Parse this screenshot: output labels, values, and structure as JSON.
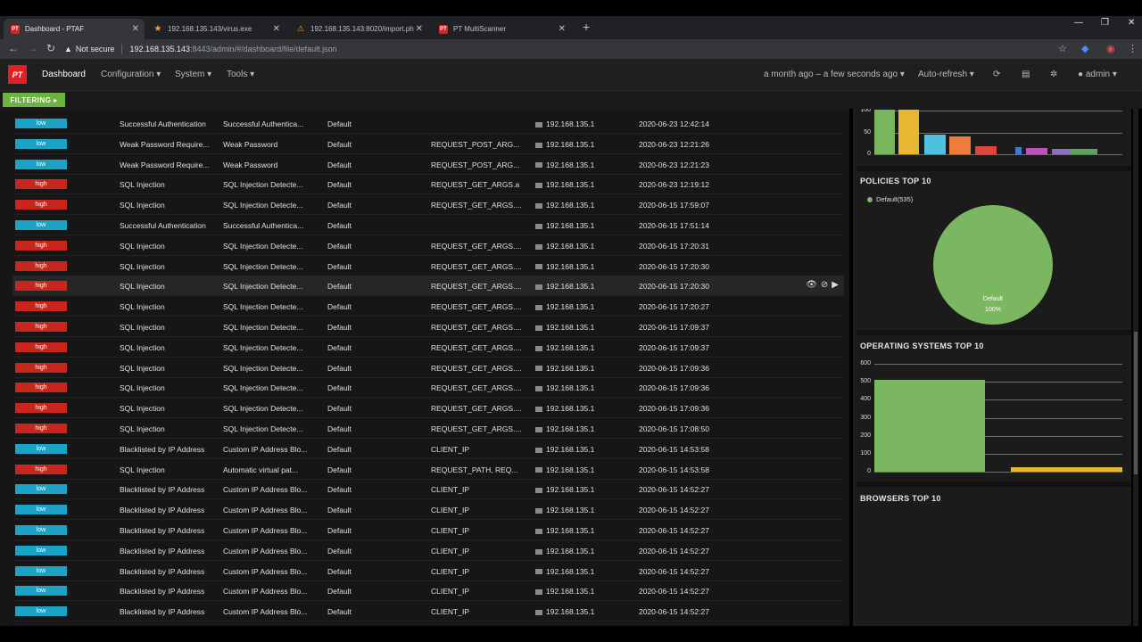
{
  "browser": {
    "tabs": [
      {
        "title": "Dashboard - PTAF",
        "icon": "pt-favicon",
        "active": true
      },
      {
        "title": "192.168.135.143/virus.exe",
        "icon": "star-icon"
      },
      {
        "title": "192.168.135.143:8020/import.ph",
        "icon": "warning-icon"
      },
      {
        "title": "PT MultiScanner",
        "icon": "pt-favicon"
      }
    ],
    "new_tab": "+",
    "not_secure": "Not secure",
    "url_host": "192.168.135.143",
    "url_path": ":8443/admin/#/dashboard/file/default.json"
  },
  "app": {
    "logo": "PT",
    "nav": {
      "dashboard": "Dashboard",
      "configuration": "Configuration ▾",
      "system": "System ▾",
      "tools": "Tools ▾",
      "time_range": "a month ago – a few seconds ago ▾",
      "auto_refresh": "Auto-refresh ▾",
      "user": "admin ▾"
    },
    "filtering": "FILTERING ▸"
  },
  "events": [
    {
      "sev": "low",
      "name": "Successful Authentication",
      "rule": "Successful Authentica...",
      "policy": "Default",
      "param": "",
      "ip": "192.168.135.1",
      "time": "2020-06-23 12:42:14"
    },
    {
      "sev": "low",
      "name": "Weak Password Require...",
      "rule": "Weak Password",
      "policy": "Default",
      "param": "REQUEST_POST_ARG...",
      "ip": "192.168.135.1",
      "time": "2020-06-23 12:21:26"
    },
    {
      "sev": "low",
      "name": "Weak Password Require...",
      "rule": "Weak Password",
      "policy": "Default",
      "param": "REQUEST_POST_ARG...",
      "ip": "192.168.135.1",
      "time": "2020-06-23 12:21:23"
    },
    {
      "sev": "high",
      "name": "SQL Injection",
      "rule": "SQL Injection Detecte...",
      "policy": "Default",
      "param": "REQUEST_GET_ARGS.a",
      "ip": "192.168.135.1",
      "time": "2020-06-23 12:19:12"
    },
    {
      "sev": "high",
      "name": "SQL Injection",
      "rule": "SQL Injection Detecte...",
      "policy": "Default",
      "param": "REQUEST_GET_ARGS....",
      "ip": "192.168.135.1",
      "time": "2020-06-15 17:59:07"
    },
    {
      "sev": "low",
      "name": "Successful Authentication",
      "rule": "Successful Authentica...",
      "policy": "Default",
      "param": "",
      "ip": "192.168.135.1",
      "time": "2020-06-15 17:51:14"
    },
    {
      "sev": "high",
      "name": "SQL Injection",
      "rule": "SQL Injection Detecte...",
      "policy": "Default",
      "param": "REQUEST_GET_ARGS....",
      "ip": "192.168.135.1",
      "time": "2020-06-15 17:20:31"
    },
    {
      "sev": "high",
      "name": "SQL Injection",
      "rule": "SQL Injection Detecte...",
      "policy": "Default",
      "param": "REQUEST_GET_ARGS....",
      "ip": "192.168.135.1",
      "time": "2020-06-15 17:20:30"
    },
    {
      "sev": "high",
      "name": "SQL Injection",
      "rule": "SQL Injection Detecte...",
      "policy": "Default",
      "param": "REQUEST_GET_ARGS....",
      "ip": "192.168.135.1",
      "time": "2020-06-15 17:20:30",
      "hover": true
    },
    {
      "sev": "high",
      "name": "SQL Injection",
      "rule": "SQL Injection Detecte...",
      "policy": "Default",
      "param": "REQUEST_GET_ARGS....",
      "ip": "192.168.135.1",
      "time": "2020-06-15 17:20:27"
    },
    {
      "sev": "high",
      "name": "SQL Injection",
      "rule": "SQL Injection Detecte...",
      "policy": "Default",
      "param": "REQUEST_GET_ARGS....",
      "ip": "192.168.135.1",
      "time": "2020-06-15 17:09:37"
    },
    {
      "sev": "high",
      "name": "SQL Injection",
      "rule": "SQL Injection Detecte...",
      "policy": "Default",
      "param": "REQUEST_GET_ARGS....",
      "ip": "192.168.135.1",
      "time": "2020-06-15 17:09:37"
    },
    {
      "sev": "high",
      "name": "SQL Injection",
      "rule": "SQL Injection Detecte...",
      "policy": "Default",
      "param": "REQUEST_GET_ARGS....",
      "ip": "192.168.135.1",
      "time": "2020-06-15 17:09:36"
    },
    {
      "sev": "high",
      "name": "SQL Injection",
      "rule": "SQL Injection Detecte...",
      "policy": "Default",
      "param": "REQUEST_GET_ARGS....",
      "ip": "192.168.135.1",
      "time": "2020-06-15 17:09:36"
    },
    {
      "sev": "high",
      "name": "SQL Injection",
      "rule": "SQL Injection Detecte...",
      "policy": "Default",
      "param": "REQUEST_GET_ARGS....",
      "ip": "192.168.135.1",
      "time": "2020-06-15 17:09:36"
    },
    {
      "sev": "high",
      "name": "SQL Injection",
      "rule": "SQL Injection Detecte...",
      "policy": "Default",
      "param": "REQUEST_GET_ARGS....",
      "ip": "192.168.135.1",
      "time": "2020-06-15 17:08:50"
    },
    {
      "sev": "low",
      "name": "Blacklisted by IP Address",
      "rule": "Custom IP Address Blo...",
      "policy": "Default",
      "param": "CLIENT_IP",
      "ip": "192.168.135.1",
      "time": "2020-06-15 14:53:58"
    },
    {
      "sev": "high",
      "name": "SQL Injection",
      "rule": "Automatic virtual pat...",
      "policy": "Default",
      "param": "REQUEST_PATH, REQ...",
      "ip": "192.168.135.1",
      "time": "2020-06-15 14:53:58"
    },
    {
      "sev": "low",
      "name": "Blacklisted by IP Address",
      "rule": "Custom IP Address Blo...",
      "policy": "Default",
      "param": "CLIENT_IP",
      "ip": "192.168.135.1",
      "time": "2020-06-15 14:52:27"
    },
    {
      "sev": "low",
      "name": "Blacklisted by IP Address",
      "rule": "Custom IP Address Blo...",
      "policy": "Default",
      "param": "CLIENT_IP",
      "ip": "192.168.135.1",
      "time": "2020-06-15 14:52:27"
    },
    {
      "sev": "low",
      "name": "Blacklisted by IP Address",
      "rule": "Custom IP Address Blo...",
      "policy": "Default",
      "param": "CLIENT_IP",
      "ip": "192.168.135.1",
      "time": "2020-06-15 14:52:27"
    },
    {
      "sev": "low",
      "name": "Blacklisted by IP Address",
      "rule": "Custom IP Address Blo...",
      "policy": "Default",
      "param": "CLIENT_IP",
      "ip": "192.168.135.1",
      "time": "2020-06-15 14:52:27"
    },
    {
      "sev": "low",
      "name": "Blacklisted by IP Address",
      "rule": "Custom IP Address Blo...",
      "policy": "Default",
      "param": "CLIENT_IP",
      "ip": "192.168.135.1",
      "time": "2020-06-15 14:52:27"
    },
    {
      "sev": "low",
      "name": "Blacklisted by IP Address",
      "rule": "Custom IP Address Blo...",
      "policy": "Default",
      "param": "CLIENT_IP",
      "ip": "192.168.135.1",
      "time": "2020-06-15 14:52:27"
    },
    {
      "sev": "low",
      "name": "Blacklisted by IP Address",
      "rule": "Custom IP Address Blo...",
      "policy": "Default",
      "param": "CLIENT_IP",
      "ip": "192.168.135.1",
      "time": "2020-06-15 14:52:27"
    }
  ],
  "side": {
    "policies_title": "POLICIES TOP 10",
    "policies_legend": "Default(535)",
    "pie_label": "Default",
    "pie_pct": "100%",
    "os_title": "OPERATING SYSTEMS TOP 10",
    "browsers_title": "BROWSERS TOP 10"
  },
  "colors": {
    "low": "#1ba3c6",
    "high": "#c8251d",
    "accent": "#6cb33f"
  },
  "chart_data": [
    {
      "type": "bar",
      "note_visible": "partially scrolled out of view",
      "yticks": [
        "100",
        "50",
        "0"
      ],
      "series_colors": [
        "#78b55f",
        "#e8b630",
        "#4fc1e0",
        "#f07c3c",
        "#e0453a",
        "#3a7bd5",
        "#c04fc0",
        "#8b6fc0",
        "#5aa55a"
      ],
      "values": [
        100,
        100,
        45,
        40,
        18,
        16,
        14,
        12,
        12
      ]
    },
    {
      "type": "pie",
      "categories": [
        "Default"
      ],
      "values": [
        535
      ]
    },
    {
      "type": "bar",
      "yticks": [
        "600",
        "500",
        "400",
        "300",
        "200",
        "100",
        "0"
      ],
      "ylim": [
        0,
        600
      ],
      "series_colors": [
        "#7bb661",
        "#e8b630"
      ],
      "values": [
        510,
        25
      ]
    }
  ]
}
